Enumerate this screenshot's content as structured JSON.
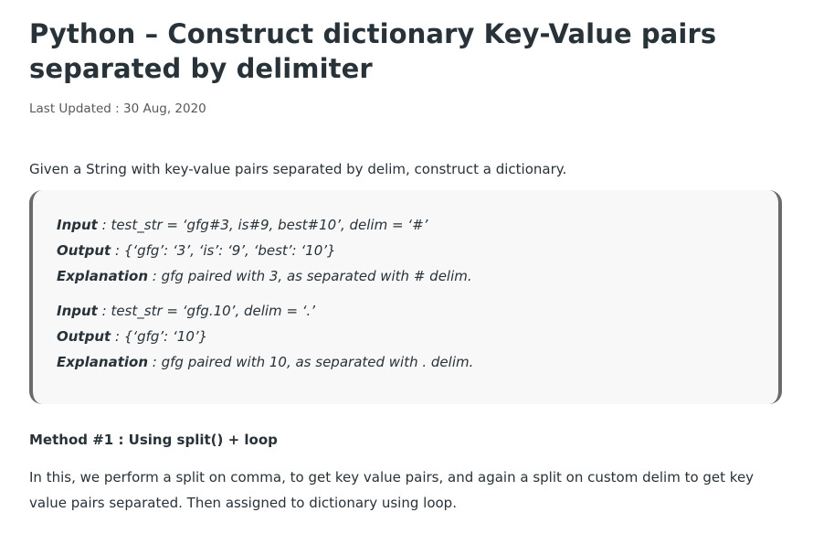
{
  "article": {
    "title": "Python – Construct dictionary Key-Value pairs separated by delimiter",
    "last_updated": "Last Updated : 30 Aug, 2020",
    "intro": "Given a String with key-value pairs separated by delim, construct a dictionary."
  },
  "examples": [
    {
      "input_label": "Input",
      "input_value": " : test_str = ‘gfg#3, is#9, best#10’, delim = ‘#’",
      "output_label": "Output",
      "output_value": " : {‘gfg’: ‘3’, ‘is’: ‘9’, ‘best’: ‘10’}",
      "explanation_label": "Explanation",
      "explanation_value": " : gfg paired with 3, as separated with # delim."
    },
    {
      "input_label": "Input",
      "input_value": " : test_str = ‘gfg.10’, delim = ‘.’",
      "output_label": "Output",
      "output_value": " : {‘gfg’: ‘10’}",
      "explanation_label": "Explanation",
      "explanation_value": " : gfg paired with 10, as separated with . delim."
    }
  ],
  "method": {
    "heading": "Method #1 : Using split() + loop",
    "description": "In this, we perform a split on comma, to get key value pairs, and again a split on custom delim to get key value pairs separated. Then assigned to dictionary using loop."
  }
}
